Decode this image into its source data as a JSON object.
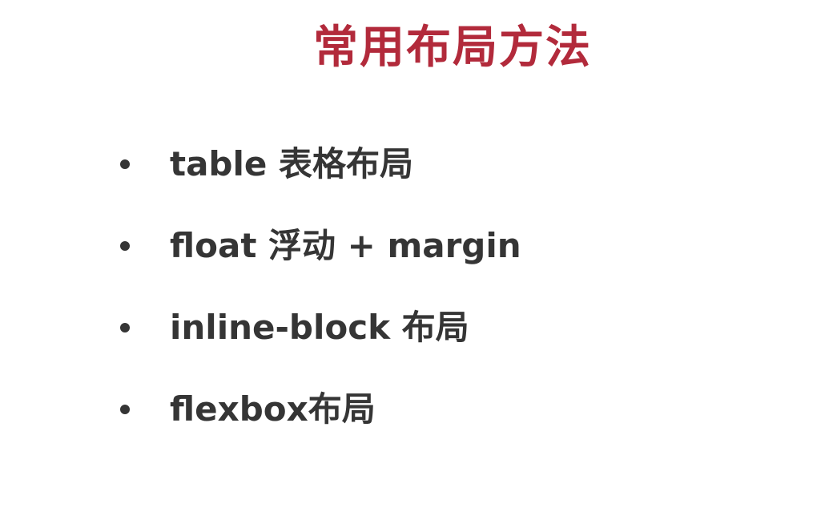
{
  "slide": {
    "title": "常用布局方法",
    "title_color": "#b22a3b",
    "text_color": "#353535",
    "bullets": [
      "table 表格布局",
      "float 浮动 + margin",
      "inline-block 布局",
      "flexbox布局"
    ]
  }
}
